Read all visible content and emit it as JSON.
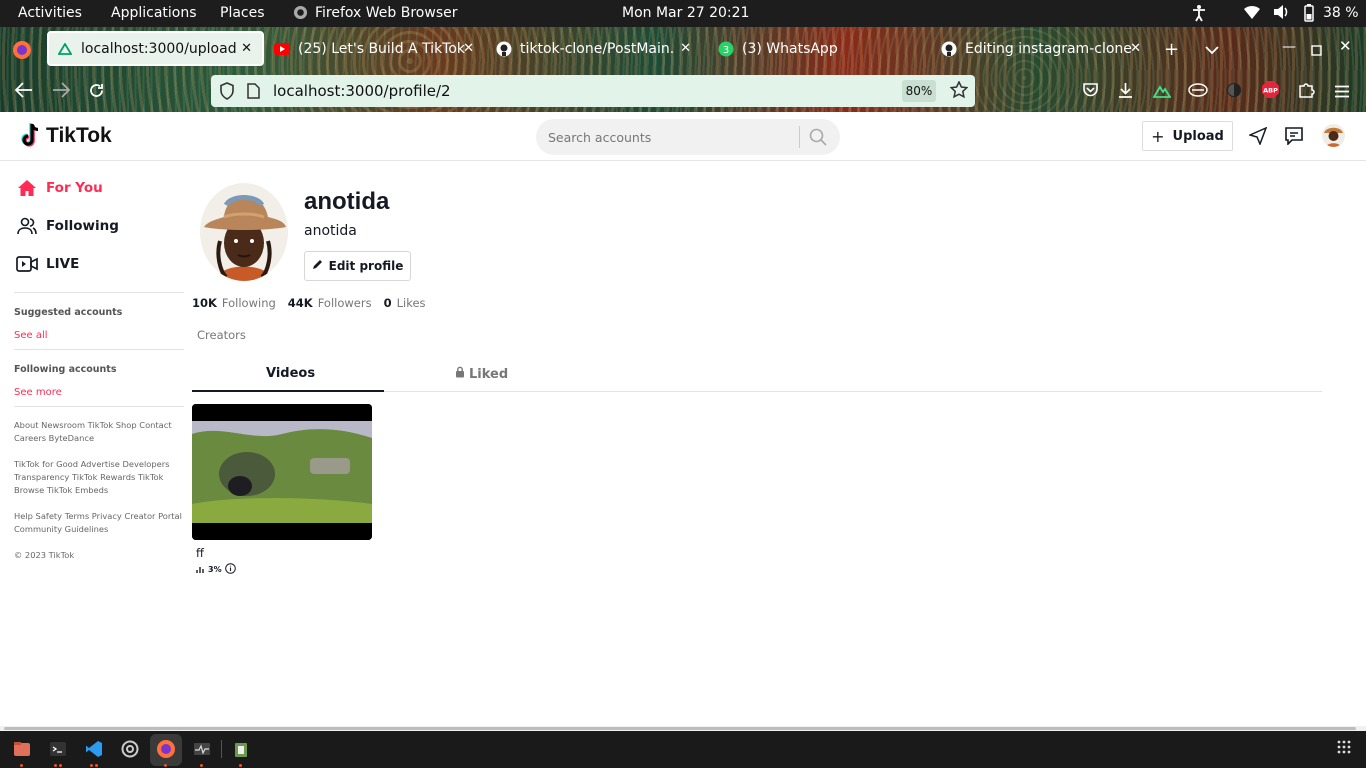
{
  "system_bar": {
    "activities": "Activities",
    "applications": "Applications",
    "places": "Places",
    "browser_name": "Firefox Web Browser",
    "datetime": "Mon Mar 27  20:21",
    "battery": "38 %"
  },
  "browser": {
    "tabs": [
      {
        "label": "localhost:3000/upload",
        "icon": "nuxt-icon",
        "active": true
      },
      {
        "label": "(25) Let's Build A TikTok",
        "icon": "youtube-icon"
      },
      {
        "label": "tiktok-clone/PostMain.",
        "icon": "github-icon"
      },
      {
        "label": "(3) WhatsApp",
        "icon": "whatsapp-icon"
      },
      {
        "label": "Editing instagram-clone",
        "icon": "github-icon"
      }
    ],
    "url": "localhost:3000/profile/2",
    "zoom": "80%"
  },
  "header": {
    "logo_text": "TikTok",
    "search_placeholder": "Search accounts",
    "upload_label": "Upload"
  },
  "sidebar": {
    "nav": [
      {
        "label": "For You",
        "icon": "home-icon"
      },
      {
        "label": "Following",
        "icon": "users-icon"
      },
      {
        "label": "LIVE",
        "icon": "live-icon"
      }
    ],
    "suggested_heading": "Suggested accounts",
    "see_all": "See all",
    "following_heading": "Following accounts",
    "see_more": "See more",
    "footer": [
      "About Newsroom TikTok Shop Contact Careers ByteDance",
      "TikTok for Good Advertise Developers Transparency TikTok Rewards TikTok Browse TikTok Embeds",
      "Help Safety Terms Privacy Creator Portal Community Guidelines",
      "© 2023 TikTok"
    ]
  },
  "profile": {
    "username": "anotida",
    "display_name": "anotida",
    "edit_label": "Edit profile",
    "following_count": "10K",
    "following_label": "Following",
    "followers_count": "44K",
    "followers_label": "Followers",
    "likes_count": "0",
    "likes_label": "Likes",
    "bio": "Creators",
    "tab_videos": "Videos",
    "tab_liked": "Liked",
    "videos": [
      {
        "caption": "ff",
        "stat": "3%"
      }
    ]
  },
  "colors": {
    "accent": "#fe2c55",
    "text": "#161823"
  }
}
